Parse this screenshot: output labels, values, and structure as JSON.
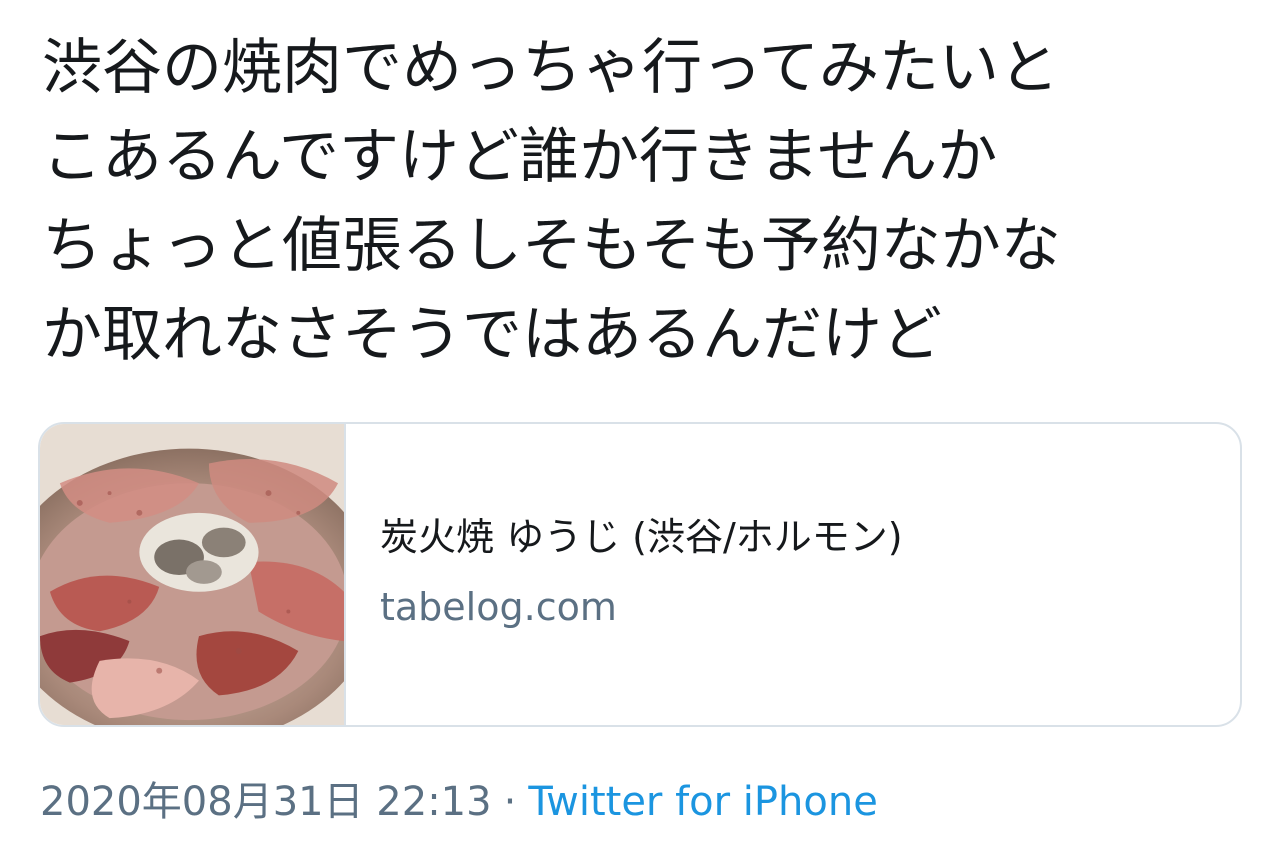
{
  "tweet": {
    "lines": [
      "渋谷の焼肉でめっちゃ行ってみたいと",
      "こあるんですけど誰か行きませんか",
      "ちょっと値張るしそもそも予約なかな",
      "か取れなさそうではあるんだけど"
    ]
  },
  "card": {
    "title": "炭火焼 ゆうじ (渋谷/ホルモン)",
    "domain": "tabelog.com",
    "image_icon": "yakiniku-photo"
  },
  "meta": {
    "timestamp": "2020年08月31日 22:13",
    "separator": "·",
    "source": "Twitter for iPhone"
  },
  "colors": {
    "text": "#16191c",
    "secondary": "#5b7083",
    "link": "#1b95e0",
    "border": "#d9e1e8"
  }
}
